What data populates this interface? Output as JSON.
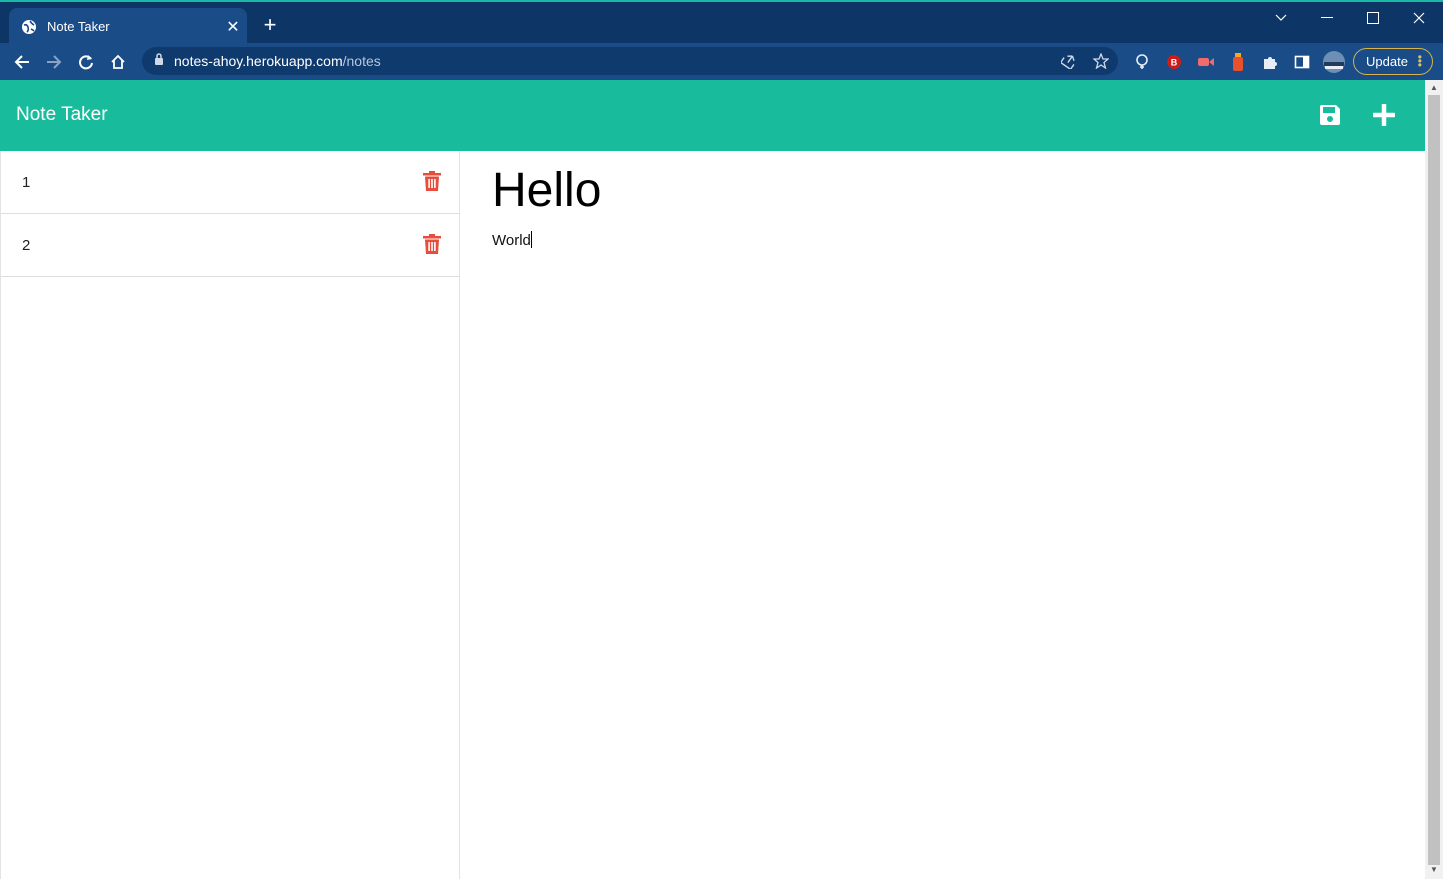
{
  "browser": {
    "tab_title": "Note Taker",
    "url_host": "notes-ahoy.herokuapp.com",
    "url_path": "/notes",
    "update_label": "Update"
  },
  "app": {
    "brand": "Note Taker",
    "notes": [
      {
        "label": "1"
      },
      {
        "label": "2"
      }
    ],
    "active_note": {
      "title": "Hello",
      "body": "World"
    },
    "colors": {
      "header": "#18bc9c",
      "trash": "#e74c3c",
      "tabstrip": "#0d3566",
      "toolbar": "#1a4d88"
    }
  }
}
